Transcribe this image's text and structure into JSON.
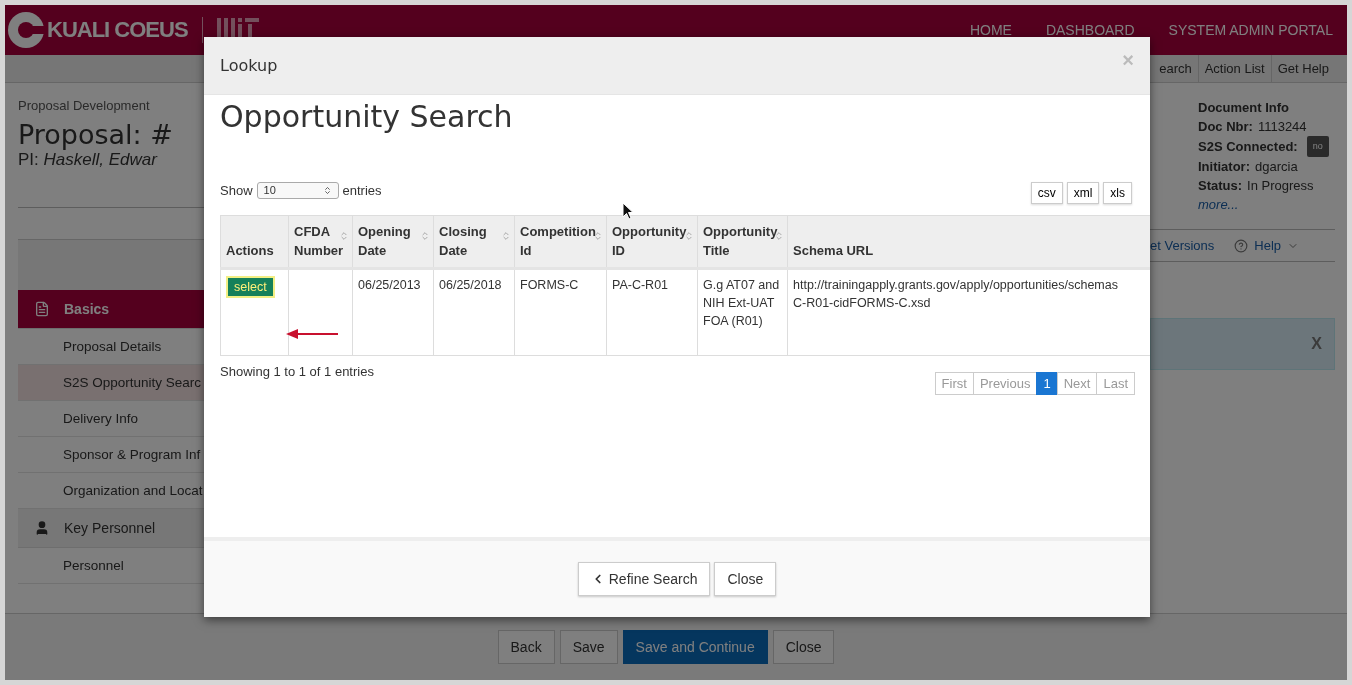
{
  "header": {
    "brand": "KUALI COEUS",
    "nav": [
      "HOME",
      "DASHBOARD",
      "SYSTEM ADMIN PORTAL"
    ]
  },
  "toolbar": [
    "earch",
    "Action List",
    "Get Help"
  ],
  "document": {
    "module": "Proposal Development",
    "title": "Proposal: #",
    "pi_label": "PI:",
    "pi_name": "Haskell, Edwar"
  },
  "sidebar": {
    "groups": [
      {
        "label": "Basics",
        "selected": true,
        "items": [
          {
            "label": "Proposal Details",
            "selected": false
          },
          {
            "label": "S2S Opportunity Searc",
            "selected": true
          },
          {
            "label": "Delivery Info",
            "selected": false
          },
          {
            "label": "Sponsor & Program Inf",
            "selected": false
          },
          {
            "label": "Organization and Locat",
            "selected": false
          }
        ]
      },
      {
        "label": "Key Personnel",
        "selected": false,
        "items": [
          {
            "label": "Personnel",
            "selected": false
          }
        ]
      }
    ]
  },
  "document_info": {
    "title": "Document Info",
    "fields": [
      {
        "label": "Doc Nbr:",
        "value": "1113244",
        "kind": "text"
      },
      {
        "label": "S2S Connected:",
        "value": "no",
        "kind": "badge"
      },
      {
        "label": "Initiator:",
        "value": "dgarcia",
        "kind": "text"
      },
      {
        "label": "Status:",
        "value": "In Progress",
        "kind": "text"
      }
    ],
    "more_link": "more..."
  },
  "right_links": {
    "versions": "et Versions",
    "help": "Help"
  },
  "alert": {
    "close": "X"
  },
  "footer_buttons": [
    {
      "label": "Back",
      "primary": false
    },
    {
      "label": "Save",
      "primary": false
    },
    {
      "label": "Save and Continue",
      "primary": true
    },
    {
      "label": "Close",
      "primary": false
    }
  ],
  "modal": {
    "title": "Lookup",
    "close": "×",
    "heading": "Opportunity Search",
    "length": {
      "before": "Show",
      "value": "10",
      "after": "entries"
    },
    "exports": [
      "csv",
      "xml",
      "xls"
    ],
    "columns": [
      {
        "label": "Actions",
        "sortable": false
      },
      {
        "label": "CFDA Number",
        "sortable": true
      },
      {
        "label": "Opening Date",
        "sortable": true
      },
      {
        "label": "Closing Date",
        "sortable": true
      },
      {
        "label": "Competition Id",
        "sortable": true
      },
      {
        "label": "Opportunity ID",
        "sortable": true
      },
      {
        "label": "Opportunity Title",
        "sortable": true
      },
      {
        "label": "Schema URL",
        "sortable": false
      }
    ],
    "rows": [
      {
        "action": "select",
        "opening_date": "06/25/2013",
        "closing_date": "06/25/2018",
        "competition_id": "FORMS-C",
        "opportunity_id": "PA-C-R01",
        "opportunity_title": "G.g AT07 and NIH Ext-UAT FOA (R01)",
        "schema_url_lines": [
          "http://trainingapply.grants.gov/apply/opportunities/schemas",
          "C-R01-cidFORMS-C.xsd"
        ]
      }
    ],
    "info": "Showing 1 to 1 of 1 entries",
    "pagination": [
      {
        "label": "First",
        "selected": false,
        "disabled": true
      },
      {
        "label": "Previous",
        "selected": false,
        "disabled": true
      },
      {
        "label": "1",
        "selected": true,
        "disabled": false
      },
      {
        "label": "Next",
        "selected": false,
        "disabled": true
      },
      {
        "label": "Last",
        "selected": false,
        "disabled": true
      }
    ],
    "buttons": [
      {
        "label": "Refine Search",
        "kind": "back"
      },
      {
        "label": "Close",
        "kind": "plain"
      }
    ]
  }
}
